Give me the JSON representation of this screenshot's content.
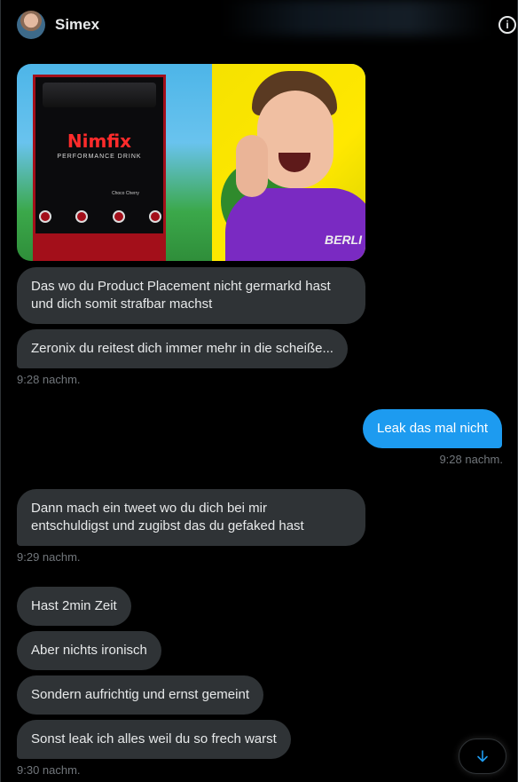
{
  "header": {
    "contact_name": "Simex",
    "avatar_icon": "user-avatar",
    "info_icon": "info-icon"
  },
  "media": {
    "product_brand": "Nimfix",
    "product_subtitle": "PERFORMANCE DRINK",
    "product_flavor": "Choco Cherry",
    "shirt_text": "BERLI"
  },
  "messages": [
    {
      "direction": "incoming",
      "text_lines": [
        "Das wo du Product Placement nicht germarkd hast",
        "und dich somit strafbar machst"
      ]
    },
    {
      "direction": "incoming",
      "text": "Zeronix du reitest dich immer mehr in die scheiße..."
    },
    {
      "direction": "timestamp-in",
      "text": "9:28 nachm."
    },
    {
      "direction": "outgoing",
      "text": "Leak das mal nicht"
    },
    {
      "direction": "timestamp-out",
      "text": "9:28 nachm."
    },
    {
      "direction": "incoming",
      "text_lines": [
        "Dann mach ein tweet wo du dich bei mir",
        "entschuldigst und zugibst das du gefaked hast"
      ]
    },
    {
      "direction": "timestamp-in",
      "text": "9:29 nachm."
    },
    {
      "direction": "incoming",
      "text": "Hast 2min Zeit"
    },
    {
      "direction": "incoming",
      "text": "Aber nichts ironisch"
    },
    {
      "direction": "incoming",
      "text": "Sondern aufrichtig und ernst gemeint"
    },
    {
      "direction": "incoming",
      "text": "Sonst leak ich alles weil du so frech warst"
    },
    {
      "direction": "timestamp-in",
      "text": "9:30 nachm."
    }
  ],
  "scroll_down_icon": "arrow-down-icon",
  "colors": {
    "background": "#000000",
    "incoming_bubble": "#2f3336",
    "outgoing_bubble": "#1d9bf0",
    "timestamp": "#71767b",
    "text": "#e7e9ea"
  }
}
